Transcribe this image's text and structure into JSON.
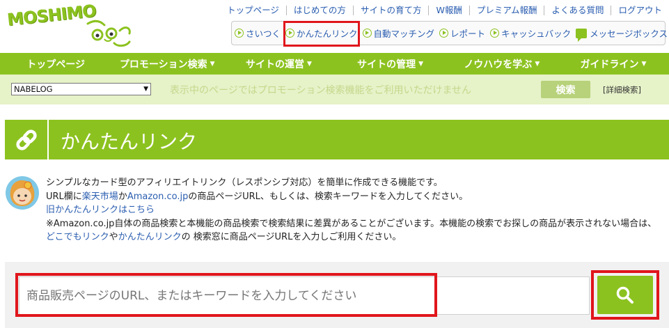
{
  "logo": {
    "text": "MOSHIMO"
  },
  "top_links": [
    {
      "label": "トップページ"
    },
    {
      "label": "はじめての方"
    },
    {
      "label": "サイトの育て方"
    },
    {
      "label": "W報酬"
    },
    {
      "label": "プレミアム報酬"
    },
    {
      "label": "よくある質問"
    },
    {
      "label": "ログアウト"
    }
  ],
  "sub_menu": [
    {
      "label": "さいつく"
    },
    {
      "label": "かんたんリンク"
    },
    {
      "label": "自動マッチング"
    },
    {
      "label": "レポート"
    },
    {
      "label": "キャッシュバック"
    },
    {
      "label": "メッセージボックス"
    }
  ],
  "nav": [
    {
      "label": "トップページ",
      "caret": ""
    },
    {
      "label": "プロモーション検索",
      "caret": "▼"
    },
    {
      "label": "サイトの運営",
      "caret": "▼"
    },
    {
      "label": "サイトの管理",
      "caret": "▼"
    },
    {
      "label": "ノウハウを学ぶ",
      "caret": "▼"
    },
    {
      "label": "ガイドライン",
      "caret": "▼"
    }
  ],
  "search_bar": {
    "site_select": "NABELOG",
    "message": "表示中のページではプロモーション検索機能をご利用いただけません",
    "button": "検索",
    "detail_link": "[詳細検索]"
  },
  "page_title": "かんたんリンク",
  "description": {
    "line1": "シンプルなカード型のアフィリエイトリンク（レスポンシブ対応）を簡単に作成できる機能です。",
    "line2_pre": "URL欄に",
    "line2_link1": "楽天市場",
    "line2_mid": "か",
    "line2_link2": "Amazon.co.jp",
    "line2_post": "の商品ページURL、もしくは、検索キーワードを入力してください。",
    "old_link": "旧かんたんリンクはこちら",
    "note_pre": "※Amazon.co.jp自体の商品検索と本機能の商品検索で検索結果に差異があることがございます。本機能の検索でお探しの商品が表示されない場合は、",
    "note_link1": "どこでもリンク",
    "note_mid": "や",
    "note_link2": "かんたんリンク",
    "note_post": "の 検索窓に商品ページURLを入力しご利用ください。"
  },
  "search_input": {
    "placeholder": "商品販売ページのURL、またはキーワードを入力してください"
  },
  "colors": {
    "brand_green": "#8cc21f",
    "highlight_red": "#e0161c",
    "link_blue": "#2a5db0"
  }
}
